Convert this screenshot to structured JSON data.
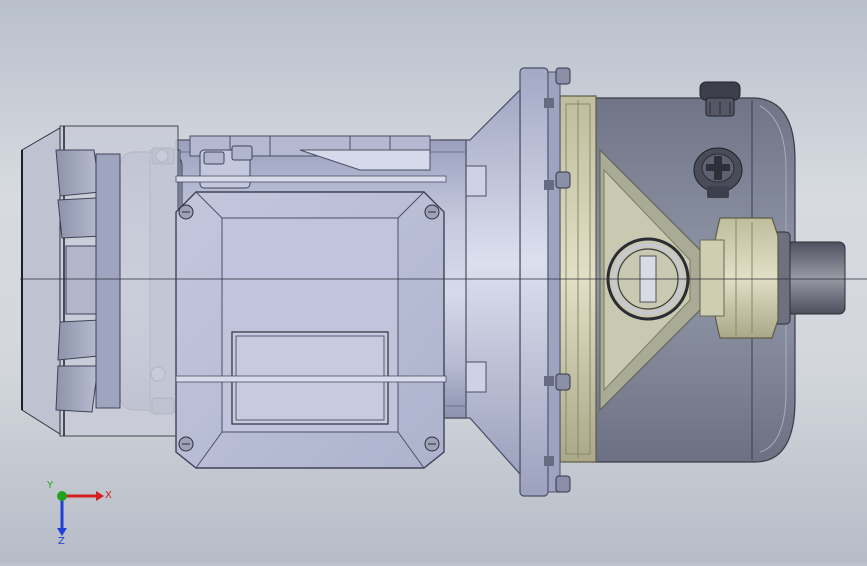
{
  "viewport": {
    "model": "pump-motor-assembly",
    "view": "top"
  },
  "triad": {
    "x_label": "X",
    "y_label": "Y",
    "z_label": "Z",
    "colors": {
      "x": "#d61f1f",
      "y": "#1fa31f",
      "z": "#1f3fd6"
    }
  }
}
